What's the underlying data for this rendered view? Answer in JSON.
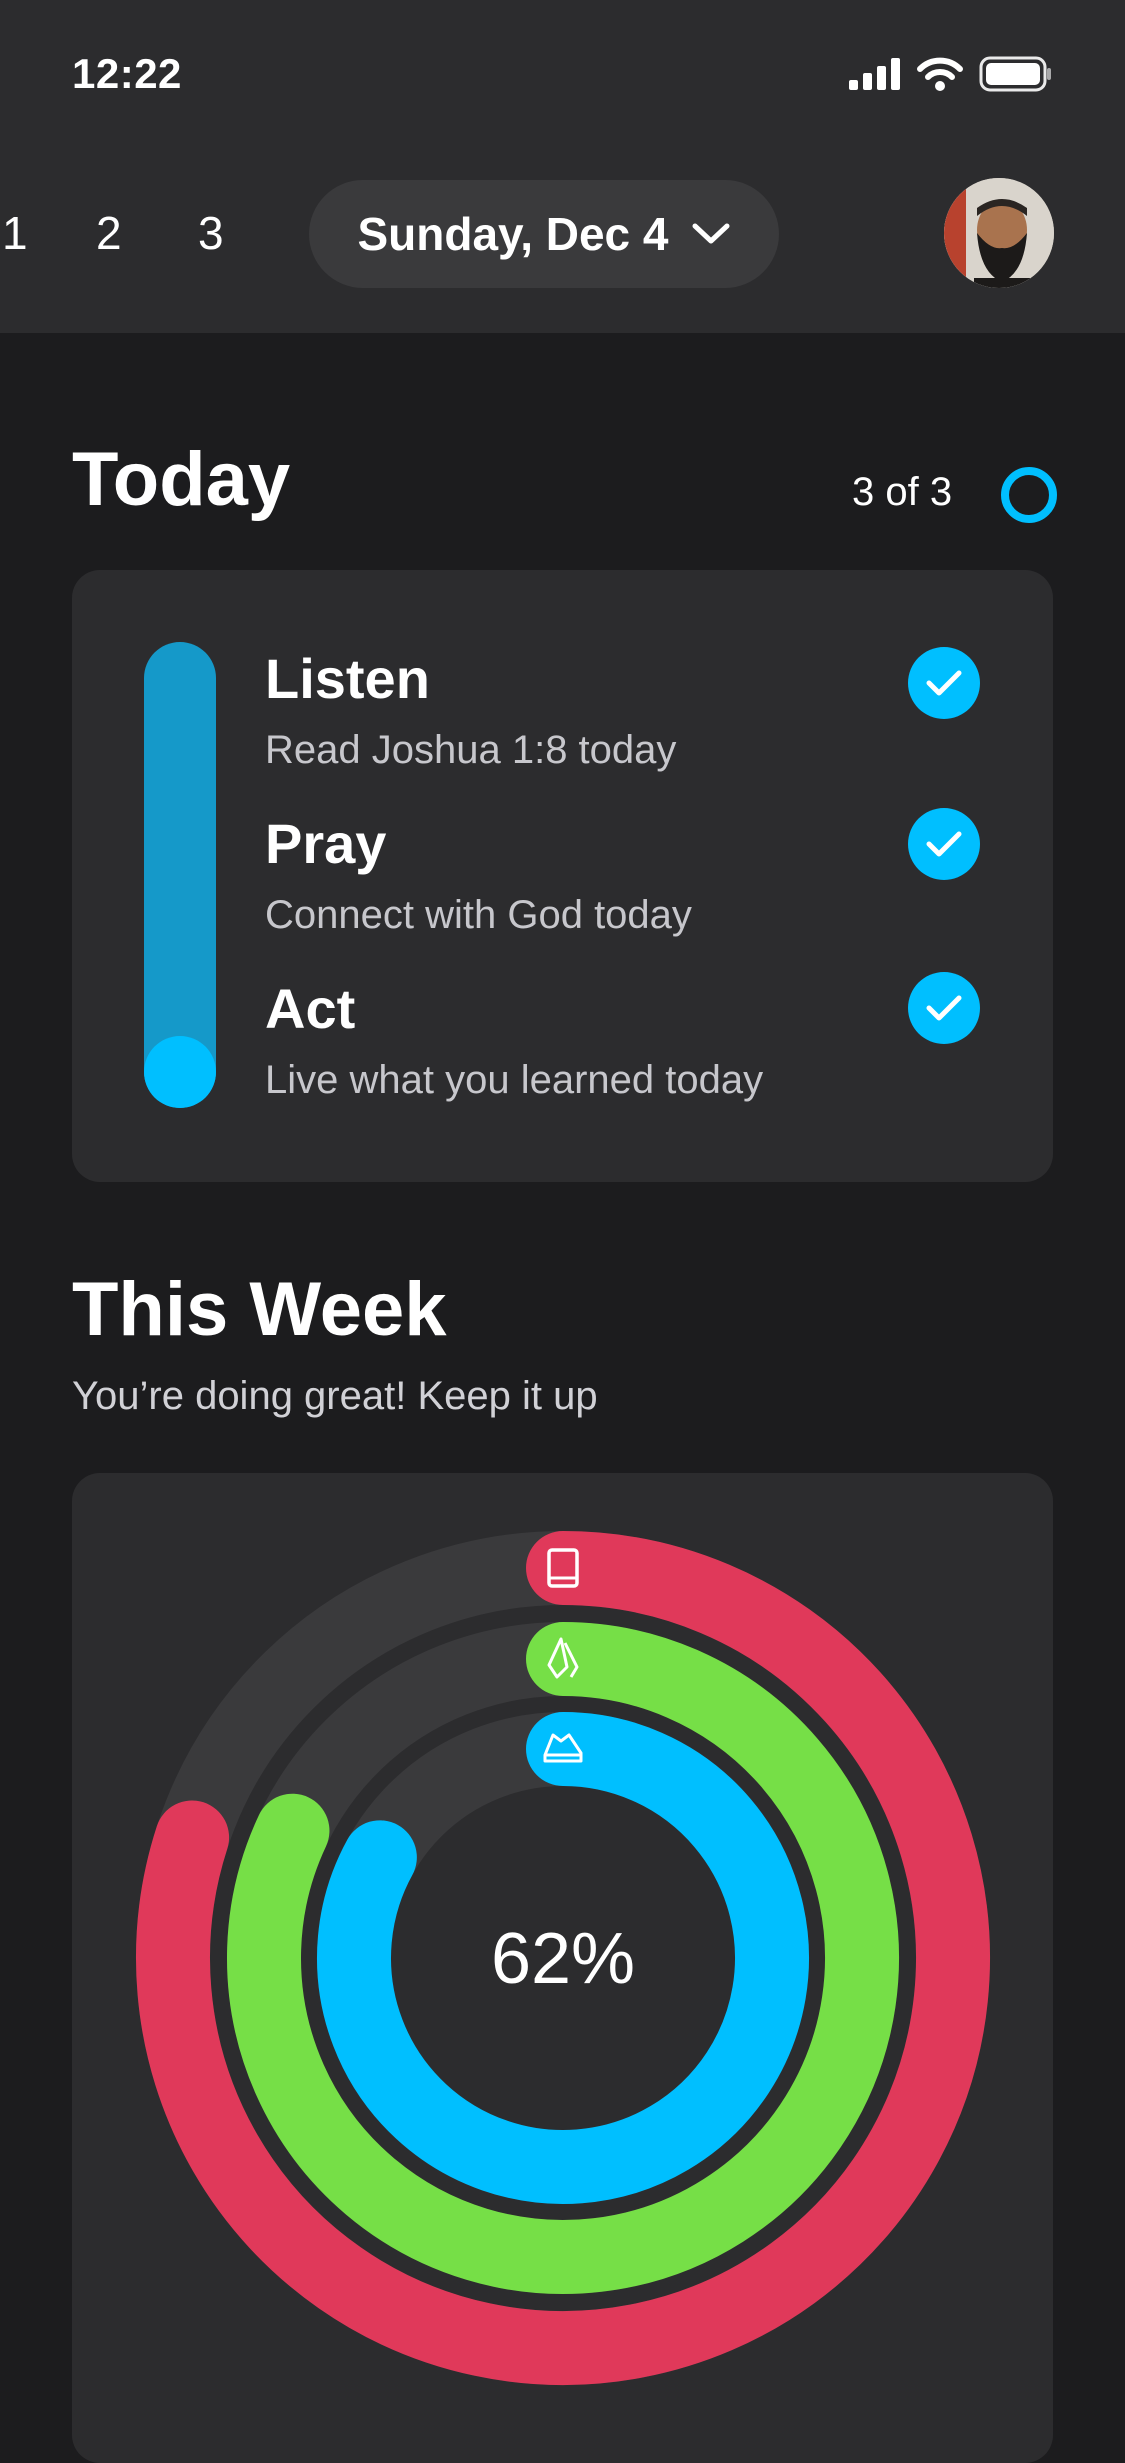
{
  "status": {
    "time": "12:22"
  },
  "header": {
    "days": [
      "1",
      "2",
      "3"
    ],
    "date_label": "Sunday, Dec 4"
  },
  "today": {
    "title": "Today",
    "progress_text": "3 of 3",
    "tasks": [
      {
        "title": "Listen",
        "subtitle": "Read Joshua 1:8 today",
        "done": true
      },
      {
        "title": "Pray",
        "subtitle": "Connect with God today",
        "done": true
      },
      {
        "title": "Act",
        "subtitle": "Live what you learned today",
        "done": true
      }
    ]
  },
  "week": {
    "title": "This Week",
    "subtitle": "You’re doing great! Keep it up",
    "percent_label": "62%",
    "rings": [
      {
        "name": "listen",
        "color": "#e0395a",
        "icon": "book-icon",
        "fraction": 0.8
      },
      {
        "name": "pray",
        "color": "#76df47",
        "icon": "praying-hands-icon",
        "fraction": 0.82
      },
      {
        "name": "act",
        "color": "#00bfff",
        "icon": "sneaker-icon",
        "fraction": 0.83
      }
    ]
  },
  "colors": {
    "accent": "#00bfff",
    "background": "#1c1c1e",
    "card": "#2c2c2e"
  }
}
